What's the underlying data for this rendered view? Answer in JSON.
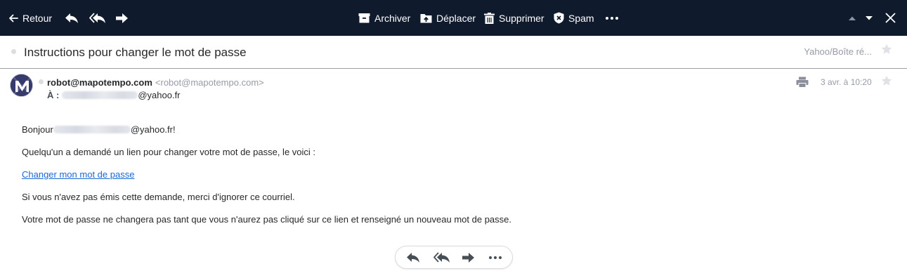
{
  "toolbar": {
    "back_label": "Retour",
    "archive_label": "Archiver",
    "move_label": "Déplacer",
    "delete_label": "Supprimer",
    "spam_label": "Spam",
    "bg_color": "#0f1a2d"
  },
  "subject": {
    "title": "Instructions pour changer le mot de passe",
    "folder": "Yahoo/Boîte ré..."
  },
  "message": {
    "sender_name": "robot@mapotempo.com",
    "sender_address": "<robot@mapotempo.com>",
    "to_label": "À :",
    "to_domain": "@yahoo.fr",
    "date": "3 avr. à 10:20"
  },
  "body": {
    "greeting_prefix": "Bonjour",
    "greeting_suffix": "@yahoo.fr!",
    "line2": "Quelqu'un a demandé un lien pour changer votre mot de passe, le voici :",
    "link_label": "Changer mon mot de passe",
    "line4": "Si vous n'avez pas émis cette demande, merci d'ignorer ce courriel.",
    "line5": "Votre mot de passe ne changera pas tant que vous n'aurez pas cliqué sur ce lien et renseigné un nouveau mot de passe.",
    "link_color": "#1a69d4"
  },
  "icons": [
    "arrow-left-icon",
    "reply-icon",
    "reply-all-icon",
    "forward-icon",
    "archive-icon",
    "move-icon",
    "trash-icon",
    "shield-icon",
    "more-icon",
    "chevron-up-icon",
    "chevron-down-icon",
    "close-icon",
    "star-icon",
    "print-icon"
  ]
}
